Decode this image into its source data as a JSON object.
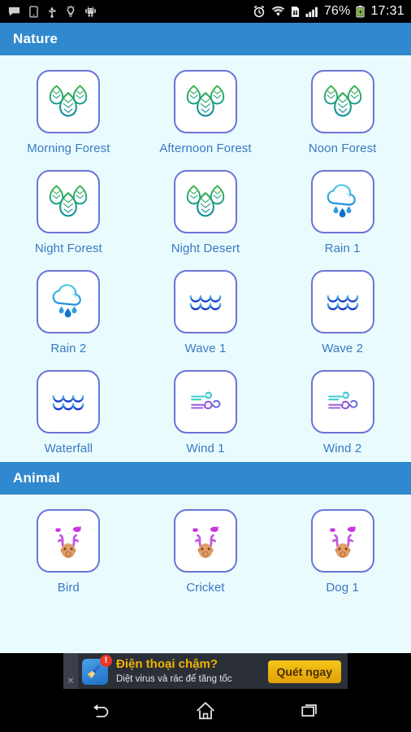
{
  "statusbar": {
    "left_icons": [
      "message-icon",
      "device-icon",
      "usb-icon",
      "bulb-icon",
      "android-robot-icon"
    ],
    "right_icons": [
      "alarm-clock-icon",
      "wifi-icon",
      "sim-card-icon",
      "signal-bars-icon",
      "battery-icon"
    ],
    "battery_percent": "76%",
    "clock": "17:31"
  },
  "sections": [
    {
      "title": "Nature",
      "items": [
        {
          "label": "Morning Forest",
          "icon": "forest-leaves-icon"
        },
        {
          "label": "Afternoon Forest",
          "icon": "forest-leaves-icon"
        },
        {
          "label": "Noon Forest",
          "icon": "forest-leaves-icon"
        },
        {
          "label": "Night Forest",
          "icon": "forest-leaves-icon"
        },
        {
          "label": "Night Desert",
          "icon": "forest-leaves-icon"
        },
        {
          "label": "Rain 1",
          "icon": "rain-cloud-icon"
        },
        {
          "label": "Rain 2",
          "icon": "rain-cloud-icon"
        },
        {
          "label": "Wave 1",
          "icon": "wave-icon"
        },
        {
          "label": "Wave 2",
          "icon": "wave-icon"
        },
        {
          "label": "Waterfall",
          "icon": "wave-icon"
        },
        {
          "label": "Wind 1",
          "icon": "wind-swirl-icon"
        },
        {
          "label": "Wind 2",
          "icon": "wind-swirl-icon"
        }
      ]
    },
    {
      "title": "Animal",
      "items": [
        {
          "label": "Bird",
          "icon": "deer-birds-icon"
        },
        {
          "label": "Cricket",
          "icon": "deer-birds-icon"
        },
        {
          "label": "Dog 1",
          "icon": "deer-birds-icon"
        }
      ]
    }
  ],
  "ad": {
    "close_label": "×",
    "badge": "!",
    "icon": "broom-cleaner-icon",
    "title": "Điện thoại chậm?",
    "subtitle": "Diệt virus và rác để tăng tốc",
    "cta": "Quét ngay"
  },
  "navbar": {
    "back": "back-icon",
    "home": "home-icon",
    "recents": "recents-icon"
  },
  "colors": {
    "header_blue": "#3089ce",
    "page_background": "#e9fbfd",
    "tile_border": "#6b74d6",
    "label_text": "#3a79c4",
    "ad_title": "#f0b400",
    "ad_cta": "#f5c518",
    "badge_red": "#e8392c"
  }
}
